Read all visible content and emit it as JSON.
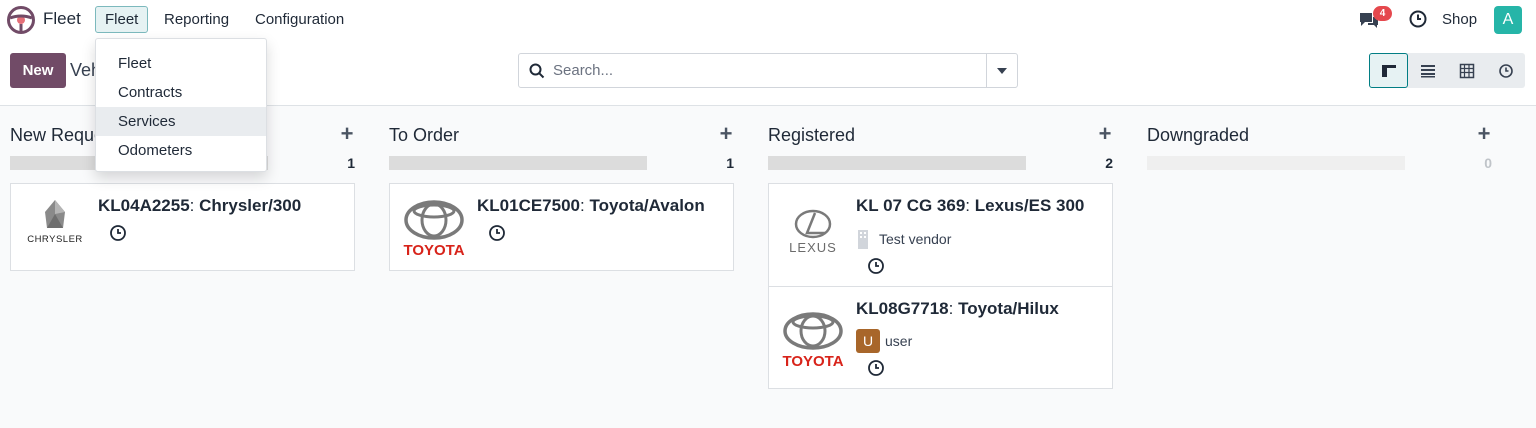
{
  "navbar": {
    "app_name": "Fleet",
    "menus": [
      "Fleet",
      "Reporting",
      "Configuration"
    ],
    "active_menu": "Fleet",
    "chat_badge": "4",
    "shop_label": "Shop",
    "avatar_initial": "A"
  },
  "control_panel": {
    "new_label": "New",
    "breadcrumb": "Vehicles",
    "search_placeholder": "Search...",
    "views": [
      "kanban",
      "list",
      "pivot",
      "activity"
    ],
    "active_view": "kanban"
  },
  "dropdown": {
    "items": [
      "Fleet",
      "Contracts",
      "Services",
      "Odometers"
    ],
    "hovered": "Services"
  },
  "kanban": {
    "columns": [
      {
        "title": "New Request",
        "count": "1",
        "progress": 1.0,
        "cards": [
          {
            "plate": "KL04A2255",
            "model": "Chrysler/300",
            "logo": "chrysler-logo",
            "logo_text": "CHRYSLER"
          }
        ]
      },
      {
        "title": "To Order",
        "count": "1",
        "progress": 1.0,
        "cards": [
          {
            "plate": "KL01CE7500",
            "model": "Toyota/Avalon",
            "logo": "toyota-logo",
            "logo_text": "TOYOTA"
          }
        ]
      },
      {
        "title": "Registered",
        "count": "2",
        "progress": 1.0,
        "cards": [
          {
            "plate": "KL 07 CG 369",
            "model": "Lexus/ES 300",
            "logo": "lexus-logo",
            "logo_text": "LEXUS",
            "vendor": "Test vendor"
          },
          {
            "plate": "KL08G7718",
            "model": "Toyota/Hilux",
            "logo": "toyota-logo",
            "logo_text": "TOYOTA",
            "user_initial": "U",
            "user": "user"
          }
        ]
      },
      {
        "title": "Downgraded",
        "count": "0",
        "progress": 0,
        "cards": []
      }
    ]
  },
  "colors": {
    "brand": "#714b67",
    "accent": "#017e84",
    "badge": "#e5484d",
    "avatar": "#26b5a8",
    "toyota_red": "#d8231a"
  }
}
